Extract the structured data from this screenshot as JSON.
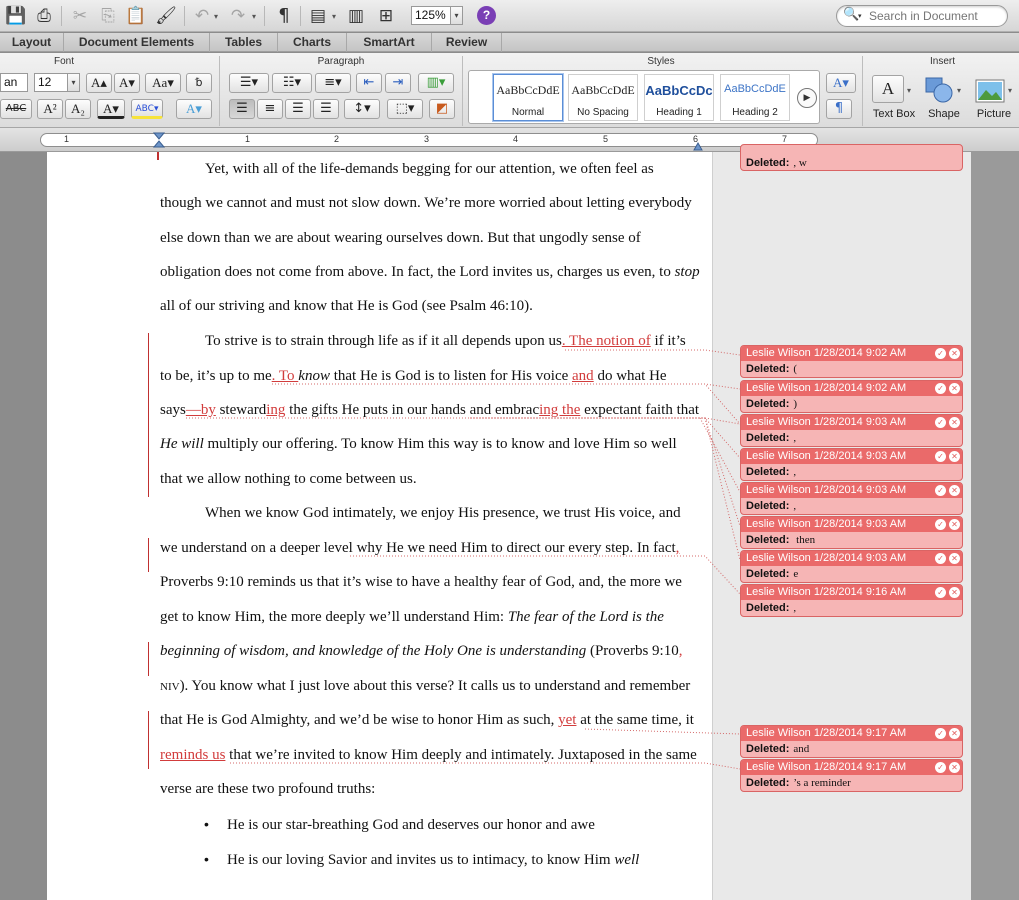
{
  "toolbar": {
    "zoom": "125%",
    "help": "?",
    "search_placeholder": "Search in Document",
    "paragraph_mark": "¶"
  },
  "tabs": [
    "Layout",
    "Document Elements",
    "Tables",
    "Charts",
    "SmartArt",
    "Review"
  ],
  "ribbon": {
    "groups": {
      "font": "Font",
      "paragraph": "Paragraph",
      "styles": "Styles",
      "insert": "Insert"
    },
    "font_name": "an",
    "font_size": "12",
    "styles": [
      {
        "sample": "AaBbCcDdE",
        "name": "Normal"
      },
      {
        "sample": "AaBbCcDdE",
        "name": "No Spacing"
      },
      {
        "sample": "AaBbCcDc",
        "name": "Heading 1"
      },
      {
        "sample": "AaBbCcDdE",
        "name": "Heading 2"
      }
    ],
    "insert": {
      "text_box": "Text Box",
      "shape": "Shape",
      "picture": "Picture"
    }
  },
  "ruler": {
    "numbers": [
      "1",
      "1",
      "2",
      "3",
      "4",
      "5",
      "6",
      "7"
    ]
  },
  "document": {
    "p1": [
      "Yet, with all of the life-demands begging for our attention, we often feel as",
      "though we cannot and must not slow down. We’re more worried about letting everybody",
      "else down than we are about wearing ourselves down. But that ungodly sense of",
      "obligation does not come from above. In fact, the Lord invites us, charges us even, to ",
      "all of our striving and know that He is God (see Psalm 46:10)."
    ],
    "p1_italic": "stop",
    "p2": {
      "l1a": "To strive is to strain through life as if it all depends upon us",
      "l1b": ". The notion of",
      "l1c": " if it’s",
      "l2a": "to be, it’s up to me",
      "l2b": ". To ",
      "l2c": "know",
      "l2d": " that He is God is to listen for His voice ",
      "l2e": "and",
      "l2f": " do what He",
      "l3a": "says",
      "l3b": "—by",
      "l3c": " steward",
      "l3d": "ing",
      "l3e": " the gifts He puts in our hands and embrac",
      "l3f": "ing the",
      "l3g": " expectant faith that",
      "l4a": "He will",
      "l4b": " multiply our offering. To know Him this way is to know and love Him so well",
      "l5": "that we allow nothing to come between us."
    },
    "p3": {
      "l1": "When we know God intimately, we enjoy His presence, we trust His voice, and",
      "l2a": "we understand on a deeper level",
      "l2b": " why He we need Him to direct our every step. In fact",
      "l2c": ",",
      "l3": "Proverbs 9:10 reminds us that it’s wise to have a healthy fear of God, and, the more we",
      "l4a": "get to know Him, the more deeply we’ll understand Him: ",
      "l4b": "The fear of the Lord is the",
      "l5a": "beginning of wisdom, and knowledge of the Holy One is understanding",
      "l5b": " (Proverbs 9:10",
      "l5c": ",",
      "l6a": "NIV",
      "l6b": "). You know what I just love about this verse? It calls us to understand and remember",
      "l7a": "that He is God Almighty, and we’d be wise to honor Him as such, ",
      "l7b": "yet",
      "l7c": " at the same time, it",
      "l8a": "reminds us",
      "l8b": " that we’re invited to know Him deeply and intimately. Juxtaposed in the same",
      "l9": "verse are these two profound truths:"
    },
    "bullets": [
      {
        "text": "He is our star-breathing God and deserves our honor and awe",
        "italic": ""
      },
      {
        "text": "He is our loving Savior and invites us to intimacy, to know Him ",
        "italic": "well"
      }
    ]
  },
  "comments": [
    {
      "header": "",
      "label": "Deleted:",
      "value": ", w"
    },
    {
      "header": "Leslie Wilson 1/28/2014 9:02 AM",
      "label": "Deleted:",
      "value": "("
    },
    {
      "header": "Leslie Wilson 1/28/2014 9:02 AM",
      "label": "Deleted:",
      "value": ")"
    },
    {
      "header": "Leslie Wilson 1/28/2014 9:03 AM",
      "label": "Deleted:",
      "value": ","
    },
    {
      "header": "Leslie Wilson 1/28/2014 9:03 AM",
      "label": "Deleted:",
      "value": ","
    },
    {
      "header": "Leslie Wilson 1/28/2014 9:03 AM",
      "label": "Deleted:",
      "value": ","
    },
    {
      "header": "Leslie Wilson 1/28/2014 9:03 AM",
      "label": "Deleted:",
      "value": " then"
    },
    {
      "header": "Leslie Wilson 1/28/2014 9:03 AM",
      "label": "Deleted:",
      "value": "e"
    },
    {
      "header": "Leslie Wilson 1/28/2014 9:16 AM",
      "label": "Deleted:",
      "value": ","
    },
    {
      "header": "Leslie Wilson 1/28/2014 9:17 AM",
      "label": "Deleted:",
      "value": "and"
    },
    {
      "header": "Leslie Wilson 1/28/2014 9:17 AM",
      "label": "Deleted:",
      "value": "’s a reminder"
    }
  ]
}
